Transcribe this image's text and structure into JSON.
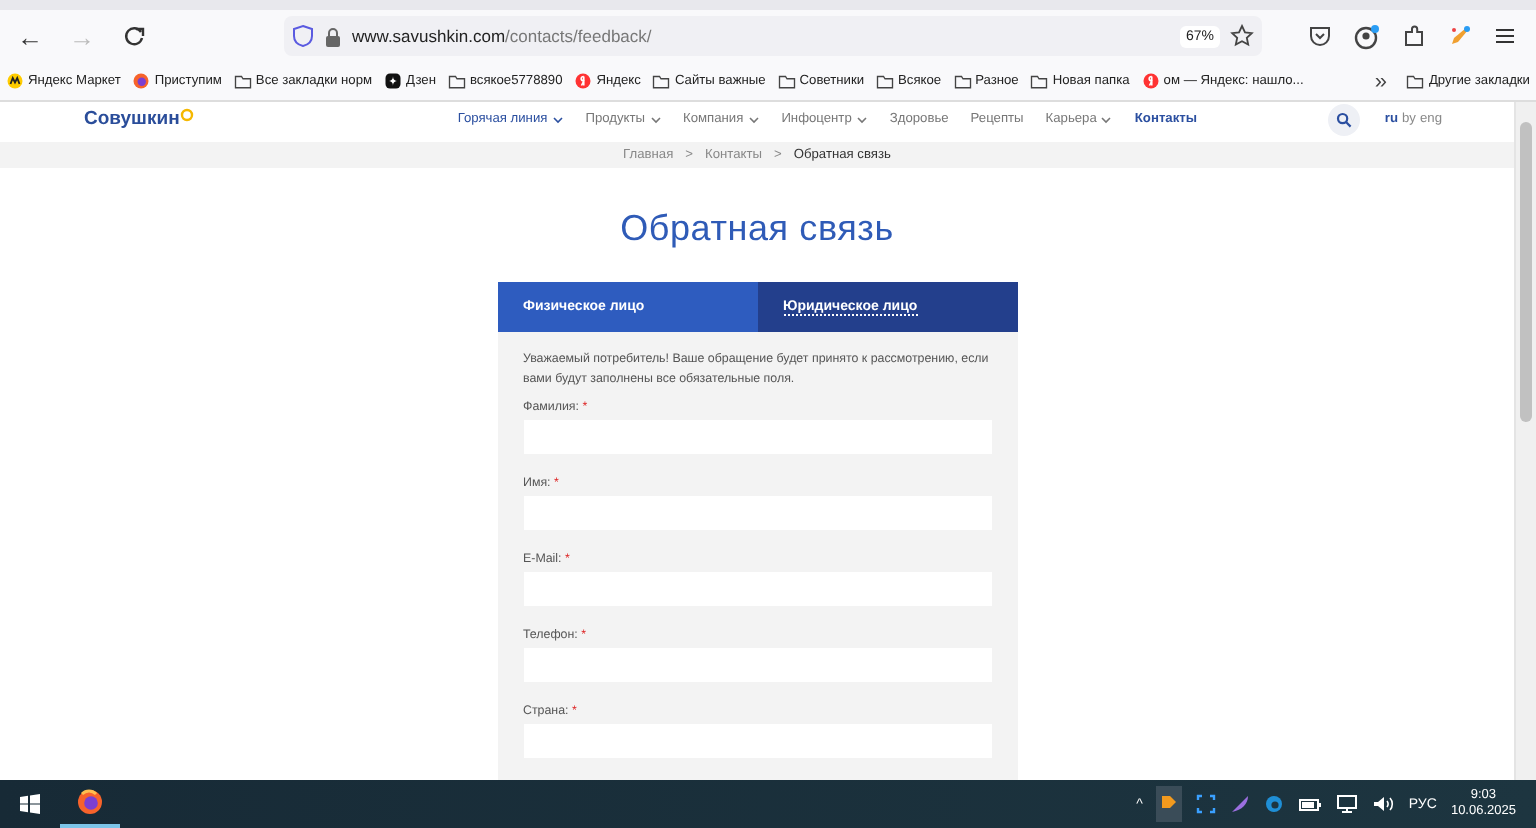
{
  "browser": {
    "back": "←",
    "forward": "→",
    "forward_disabled": true,
    "url_host": "www.savushkin.com",
    "url_path": "/contacts/feedback/",
    "zoom": "67%"
  },
  "bookmarks": [
    {
      "label": "Яндекс Маркет",
      "kind": "market"
    },
    {
      "label": "Приступим",
      "kind": "firefox"
    },
    {
      "label": "Все закладки норм",
      "kind": "folder"
    },
    {
      "label": "Дзен",
      "kind": "dzen"
    },
    {
      "label": "всякое5778890",
      "kind": "folder"
    },
    {
      "label": "Яндекс",
      "kind": "yandex"
    },
    {
      "label": "Сайты важные",
      "kind": "folder"
    },
    {
      "label": "Советники",
      "kind": "folder"
    },
    {
      "label": "Всякое",
      "kind": "folder"
    },
    {
      "label": "Разное",
      "kind": "folder"
    },
    {
      "label": "Новая папка",
      "kind": "folder"
    },
    {
      "label": "ом — Яндекс: нашло...",
      "kind": "yandex"
    }
  ],
  "bookmarks_more": "»",
  "other_bookmarks": "Другие закладки",
  "site": {
    "logo": "Совушкин",
    "nav": [
      {
        "label": "Горячая линия",
        "dropdown": true,
        "kind": "accent"
      },
      {
        "label": "Продукты",
        "dropdown": true,
        "kind": "plain"
      },
      {
        "label": "Компания",
        "dropdown": true,
        "kind": "plain"
      },
      {
        "label": "Инфоцентр",
        "dropdown": true,
        "kind": "plain"
      },
      {
        "label": "Здоровье",
        "dropdown": false,
        "kind": "plain"
      },
      {
        "label": "Рецепты",
        "dropdown": false,
        "kind": "plain"
      },
      {
        "label": "Карьера",
        "dropdown": true,
        "kind": "plain"
      },
      {
        "label": "Контакты",
        "dropdown": false,
        "kind": "current"
      }
    ],
    "languages": [
      {
        "label": "ru",
        "selected": true
      },
      {
        "label": "by",
        "selected": false
      },
      {
        "label": "eng",
        "selected": false
      }
    ],
    "breadcrumbs": [
      {
        "label": "Главная",
        "current": false
      },
      {
        "label": "Контакты",
        "current": false
      },
      {
        "label": "Обратная связь",
        "current": true
      }
    ],
    "breadcrumb_separator": ">",
    "title": "Обратная связь",
    "tabs": [
      {
        "label": "Физическое лицо",
        "selected": true
      },
      {
        "label": "Юридическое лицо",
        "selected": false
      }
    ],
    "intro": "Уважаемый потребитель! Ваше обращение будет принято к рассмотрению, если вами будут заполнены все обязательные поля.",
    "fields": [
      {
        "label": "Фамилия:",
        "required": true
      },
      {
        "label": "Имя:",
        "required": true
      },
      {
        "label": "E-Mail:",
        "required": true
      },
      {
        "label": "Телефон:",
        "required": true
      },
      {
        "label": "Страна:",
        "required": true
      }
    ],
    "required_mark": "*"
  },
  "taskbar": {
    "language": "РУС",
    "time": "9:03",
    "date": "10.06.2025",
    "tray_expand": "^"
  }
}
